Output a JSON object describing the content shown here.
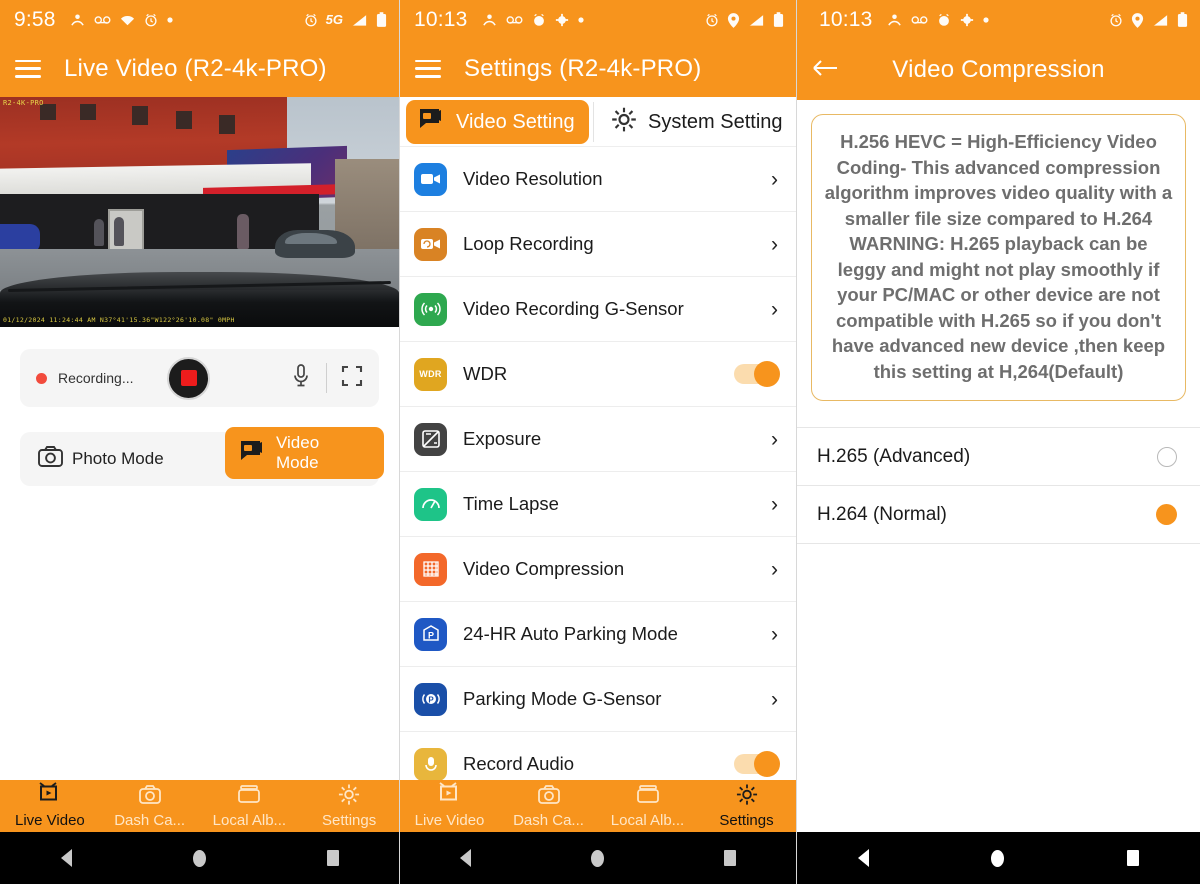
{
  "panel1": {
    "status_bar": {
      "time": "9:58",
      "network": "5G",
      "icons_left": [
        "contacts-icon",
        "voicemail-icon",
        "wifi-icon",
        "alarm-clock-icon",
        "dot-icon"
      ],
      "icons_right": [
        "alarm-icon",
        "network-5g-icon",
        "signal-icon",
        "battery-icon"
      ]
    },
    "app_bar": {
      "menu_icon": "hamburger-menu-icon",
      "title": "Live Video (R2-4k-PRO)"
    },
    "preview": {
      "overlay_top_left": "R2-4K-PRO",
      "overlay_bottom_left": "01/12/2024 11:24:44 AM   N37°41'15.36\"W122°26'10.08\"  0MPH"
    },
    "recording_card": {
      "status_text": "Recording...",
      "record_button": "stop-record-button",
      "mic_icon": "microphone-icon",
      "fullscreen_icon": "fullscreen-icon"
    },
    "mode_card": {
      "photo_label": "Photo Mode",
      "photo_icon": "camera-icon",
      "video_label": "Video Mode",
      "video_icon": "video-camera-icon",
      "active": "Video Mode"
    },
    "bottom_nav": [
      {
        "label": "Live Video",
        "icon": "live-video-icon",
        "active": true
      },
      {
        "label": "Dash Ca...",
        "icon": "dash-cam-icon",
        "active": false
      },
      {
        "label": "Local Alb...",
        "icon": "local-album-icon",
        "active": false
      },
      {
        "label": "Settings",
        "icon": "gear-icon",
        "active": false
      }
    ]
  },
  "panel2": {
    "status_bar": {
      "time": "10:13"
    },
    "app_bar": {
      "menu_icon": "hamburger-menu-icon",
      "title": "Settings (R2-4k-PRO)"
    },
    "tabs": [
      {
        "label": "Video Setting",
        "icon": "video-camera-icon",
        "active": true
      },
      {
        "label": "System Setting",
        "icon": "gear-icon",
        "active": false
      }
    ],
    "settings": [
      {
        "label": "Video Resolution",
        "icon": "video-camera-icon",
        "color": "#1d7fe0",
        "glyph": "▶",
        "control": "chevron",
        "value": "›"
      },
      {
        "label": "Loop Recording",
        "icon": "loop-recording-icon",
        "color": "#d98324",
        "glyph": "↺",
        "control": "chevron",
        "value": "›"
      },
      {
        "label": "Video Recording G-Sensor",
        "icon": "g-sensor-icon",
        "color": "#2ea84f",
        "glyph": "((•))",
        "control": "chevron",
        "value": "›"
      },
      {
        "label": "WDR",
        "icon": "wdr-icon",
        "color": "#e0a620",
        "glyph": "WDR",
        "control": "toggle",
        "value": "on"
      },
      {
        "label": "Exposure",
        "icon": "exposure-icon",
        "color": "#434343",
        "glyph": "◨",
        "control": "chevron",
        "value": "›"
      },
      {
        "label": "Time Lapse",
        "icon": "time-lapse-icon",
        "color": "#1ec488",
        "glyph": "⏱",
        "control": "chevron",
        "value": "›"
      },
      {
        "label": "Video Compression",
        "icon": "compression-icon",
        "color": "#f3682a",
        "glyph": "▓",
        "control": "chevron",
        "value": "›"
      },
      {
        "label": "24-HR Auto Parking Mode",
        "icon": "parking-icon",
        "color": "#1f58c4",
        "glyph": "P",
        "control": "chevron",
        "value": "›"
      },
      {
        "label": "Parking Mode G-Sensor",
        "icon": "parking-gsensor-icon",
        "color": "#1a4fa8",
        "glyph": "P",
        "control": "chevron",
        "value": "›"
      },
      {
        "label": "Record Audio",
        "icon": "record-audio-icon",
        "color": "#e8b63c",
        "glyph": "♫",
        "control": "toggle",
        "value": "on"
      }
    ],
    "bottom_nav": [
      {
        "label": "Live Video",
        "icon": "live-video-icon",
        "active": false
      },
      {
        "label": "Dash Ca...",
        "icon": "dash-cam-icon",
        "active": false
      },
      {
        "label": "Local Alb...",
        "icon": "local-album-icon",
        "active": false
      },
      {
        "label": "Settings",
        "icon": "gear-icon",
        "active": true
      }
    ]
  },
  "panel3": {
    "status_bar": {
      "time": "10:13"
    },
    "app_bar": {
      "back_icon": "back-arrow-icon",
      "title": "Video Compression"
    },
    "notice": "H.256 HEVC = High-Efficiency Video Coding- This advanced compression algorithm improves video quality with a smaller file size compared to H.264 WARNING: H.265 playback can be leggy and might not play smoothly if your PC/MAC or other device are not compatible with H.265 so if you don't have advanced new device ,then keep this setting at H,264(Default)",
    "options": [
      {
        "label": "H.265 (Advanced)",
        "selected": false
      },
      {
        "label": "H.264 (Normal)",
        "selected": true
      }
    ]
  },
  "theme": {
    "accent": "#F7941D",
    "notice_border": "#e8b964",
    "notice_text": "#6e6e6e",
    "radio_selected": "#F7941D"
  }
}
